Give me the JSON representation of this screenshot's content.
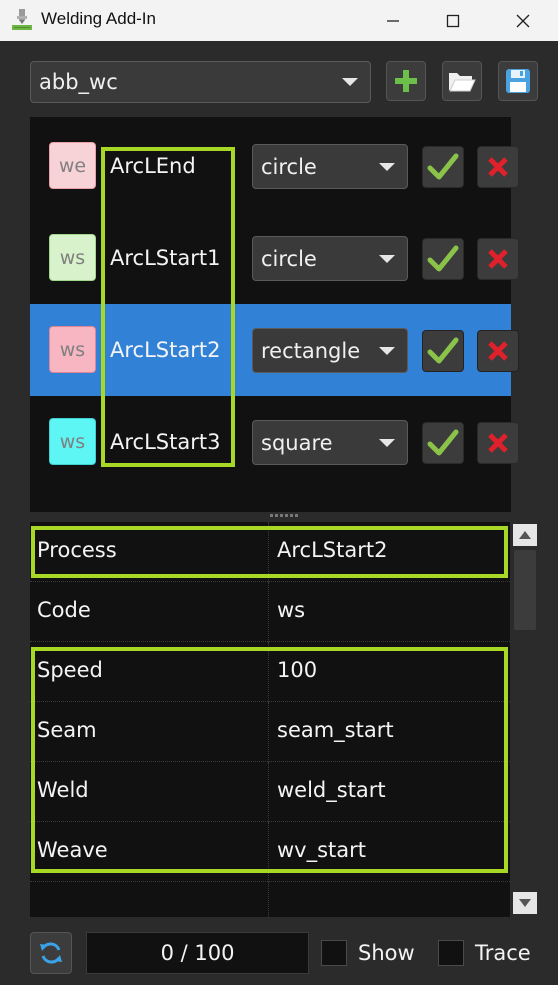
{
  "window": {
    "title": "Welding Add-In",
    "minimize_icon": "minimize-icon",
    "maximize_icon": "maximize-icon",
    "close_icon": "close-icon"
  },
  "toolbar": {
    "profile_value": "abb_wc",
    "add_icon": "plus-icon",
    "open_icon": "folder-open-icon",
    "save_icon": "floppy-disk-icon"
  },
  "process_list": [
    {
      "code": "we",
      "name": "ArcLEnd",
      "shape": "circle",
      "badge_color": "#f7d3d8",
      "badge_border": "#e8a0a8",
      "selected": false
    },
    {
      "code": "ws",
      "name": "ArcLStart1",
      "shape": "circle",
      "badge_color": "#d8f3cc",
      "badge_border": "#9fd88a",
      "selected": false
    },
    {
      "code": "ws",
      "name": "ArcLStart2",
      "shape": "rectangle",
      "badge_color": "#f8b6c2",
      "badge_border": "#e08595",
      "selected": true
    },
    {
      "code": "ws",
      "name": "ArcLStart3",
      "shape": "square",
      "badge_color": "#5ef5f5",
      "badge_border": "#3fd0d0",
      "selected": false
    }
  ],
  "properties": [
    {
      "key": "Process",
      "value": "ArcLStart2"
    },
    {
      "key": "Code",
      "value": "ws"
    },
    {
      "key": "Speed",
      "value": "100"
    },
    {
      "key": "Seam",
      "value": "seam_start"
    },
    {
      "key": "Weld",
      "value": "weld_start"
    },
    {
      "key": "Weave",
      "value": "wv_start"
    }
  ],
  "footer": {
    "progress_text": "0 / 100",
    "show_label": "Show",
    "trace_label": "Trace",
    "show_checked": false,
    "trace_checked": false
  },
  "colors": {
    "accent_selection": "#3182d7",
    "highlight_outline": "#a8d826",
    "check_green": "#8bc34a",
    "delete_red": "#e0202a"
  }
}
